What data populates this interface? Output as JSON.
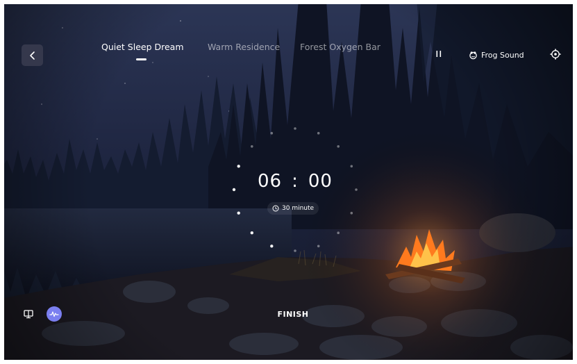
{
  "nav": {
    "tabs": [
      {
        "label": "Quiet Sleep Dream",
        "active": true
      },
      {
        "label": "Warm Residence",
        "active": false
      },
      {
        "label": "Forest Oxygen Bar",
        "active": false
      }
    ]
  },
  "controls": {
    "sound_label": "Frog Sound"
  },
  "timer": {
    "minutes": "06",
    "separator": ":",
    "seconds": "00",
    "duration_label": "30 minute"
  },
  "footer": {
    "finish_label": "FINISH"
  },
  "colors": {
    "accent": "#7b7ff0",
    "text": "#ffffff",
    "fire": "#ff8a2a"
  }
}
